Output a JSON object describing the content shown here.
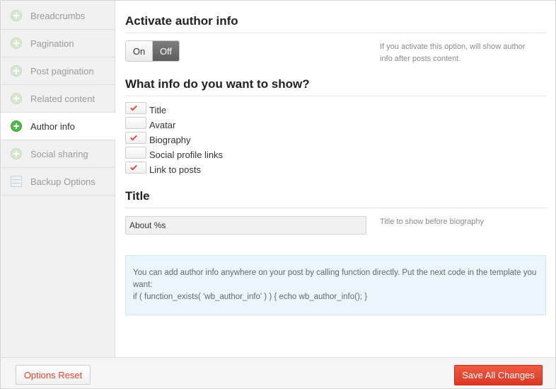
{
  "sidebar": {
    "items": [
      {
        "label": "Breadcrumbs",
        "icon": "plus-circle-icon",
        "active": false
      },
      {
        "label": "Pagination",
        "icon": "plus-circle-icon",
        "active": false
      },
      {
        "label": "Post pagination",
        "icon": "plus-circle-icon",
        "active": false
      },
      {
        "label": "Related content",
        "icon": "plus-circle-icon",
        "active": false
      },
      {
        "label": "Author info",
        "icon": "plus-circle-icon",
        "active": true
      },
      {
        "label": "Social sharing",
        "icon": "plus-circle-icon",
        "active": false
      },
      {
        "label": "Backup Options",
        "icon": "stack-icon",
        "active": false
      }
    ]
  },
  "activate": {
    "title": "Activate author info",
    "on_label": "On",
    "off_label": "Off",
    "selected": "Off",
    "help": "If you activate this option, will show author info after posts content."
  },
  "show_info": {
    "title": "What info do you want to show?",
    "options": [
      {
        "label": "Title",
        "checked": true
      },
      {
        "label": "Avatar",
        "checked": false
      },
      {
        "label": "Biography",
        "checked": true
      },
      {
        "label": "Social profile links",
        "checked": false
      },
      {
        "label": "Link to posts",
        "checked": true
      }
    ]
  },
  "title_field": {
    "title": "Title",
    "value": "About %s",
    "help": "Title to show before biography"
  },
  "info_box": {
    "line1": "You can add author info anywhere on your post by calling function directly. Put the next code in the template you want:",
    "code": "if ( function_exists( 'wb_author_info' ) ) { echo wb_author_info(); }"
  },
  "footer": {
    "reset_label": "Options Reset",
    "save_label": "Save All Changes"
  },
  "colors": {
    "accent_red": "#e0442e",
    "active_green": "#52b948",
    "info_bg": "#eaf6fb"
  }
}
